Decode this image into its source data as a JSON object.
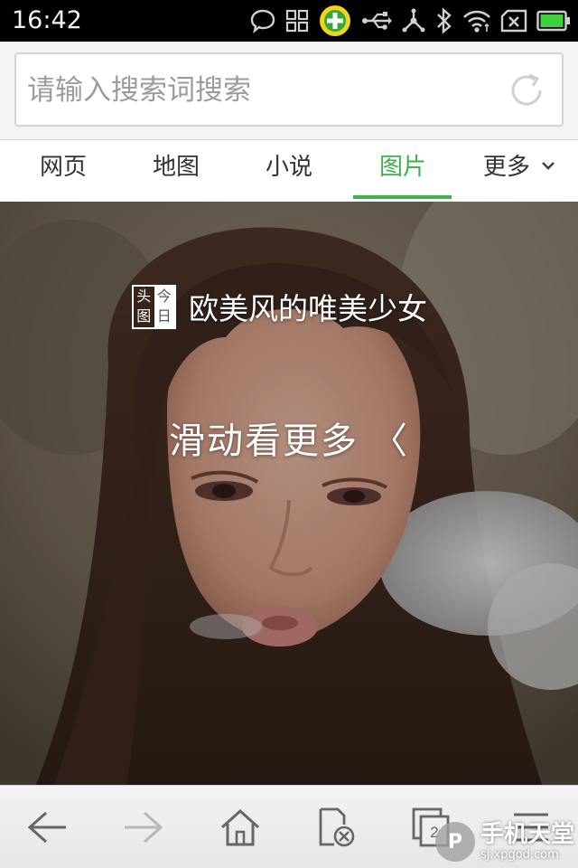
{
  "status_bar": {
    "time": "16:42",
    "icons": [
      "chat-bubble-icon",
      "app-grid-icon",
      "security-app-icon",
      "usb-icon",
      "usb-tether-icon",
      "bluetooth-icon",
      "wifi-icon",
      "no-sim-icon",
      "battery-icon"
    ]
  },
  "search": {
    "placeholder": "请输入搜索词搜索",
    "refresh_icon": "refresh-icon"
  },
  "tabs": [
    {
      "label": "网页",
      "active": false
    },
    {
      "label": "地图",
      "active": false
    },
    {
      "label": "小说",
      "active": false
    },
    {
      "label": "图片",
      "active": true
    },
    {
      "label": "更多",
      "active": false
    }
  ],
  "hero": {
    "source_logo": [
      "头",
      "今",
      "图",
      "日"
    ],
    "title": "欧美风的唯美少女",
    "swipe_hint": "滑动看更多",
    "swipe_glyph": "〈"
  },
  "toolbar": {
    "buttons": [
      "back-icon",
      "forward-icon",
      "home-icon",
      "close-page-icon",
      "windows-icon",
      "menu-icon"
    ],
    "window_count": "2"
  },
  "watermark": {
    "logo_glyph": "P",
    "name": "手机天堂",
    "url": "sj.xpgod.com"
  },
  "colors": {
    "accent": "#3cb34a",
    "status_bar": "#000000",
    "toolbar_bg": "#eeeeee"
  }
}
